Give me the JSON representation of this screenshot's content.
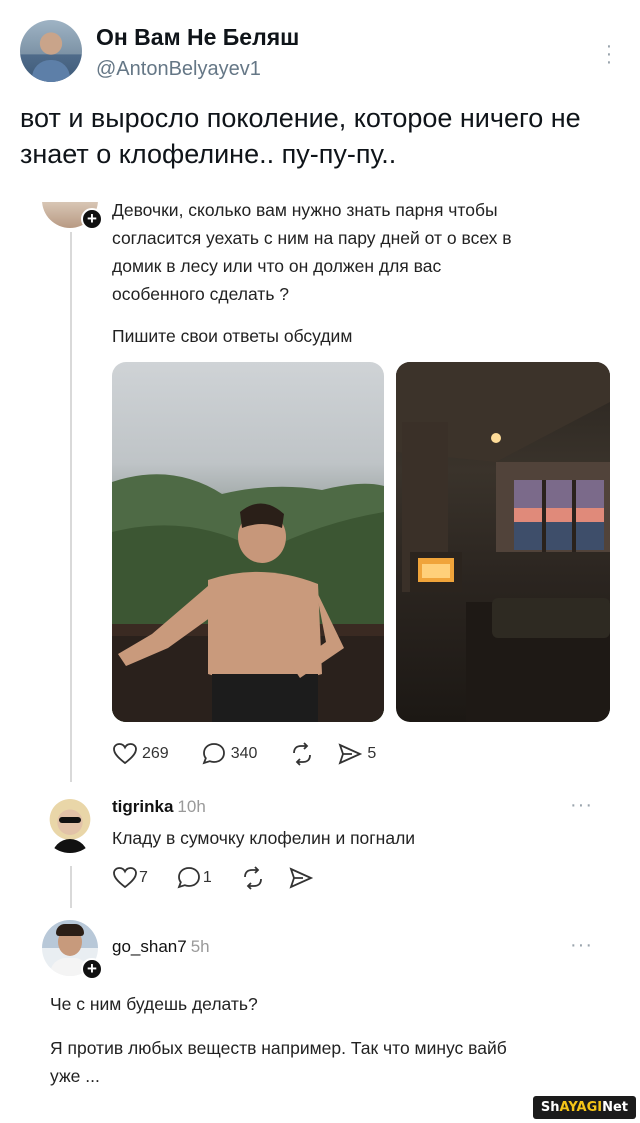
{
  "tweet": {
    "display_name": "Он Вам Не Беляш",
    "handle": "@AntonBelyayev1",
    "text": "вот и выросло поколение, которое ничего не знает о клофелине.. пу-пу-пу.."
  },
  "thread": {
    "original_post": {
      "text_line1": "Девочки, сколько вам нужно знать парня чтобы",
      "text_line2": "согласится уехать с ним на пару дней от о всех в",
      "text_line3": "домик в лесу или что он должен для вас",
      "text_line4": "особенного сделать ?",
      "text_line5": "Пишите свои ответы обсудим",
      "likes": "269",
      "comments": "340",
      "shares": "5"
    },
    "reply1": {
      "username": "tigrinka",
      "time": "10h",
      "text": "Кладу в сумочку клофелин и погнали",
      "likes": "7",
      "comments": "1"
    },
    "reply2": {
      "username": "go_shan7",
      "time": "5h",
      "text1": "Че с ним будешь делать?",
      "text2_line1": "Я против любых веществ например. Так что минус вайб",
      "text2_line2": "уже ..."
    }
  },
  "watermark": {
    "prefix": "Sh",
    "mid": "AYAGI",
    "suffix": "Net"
  },
  "icons": [
    "heart-icon",
    "comment-icon",
    "repost-icon",
    "share-icon",
    "more-icon",
    "plus-icon"
  ],
  "colors": {
    "handle": "#657786",
    "thread_line": "#d9d9d9",
    "text": "#0f1419"
  }
}
